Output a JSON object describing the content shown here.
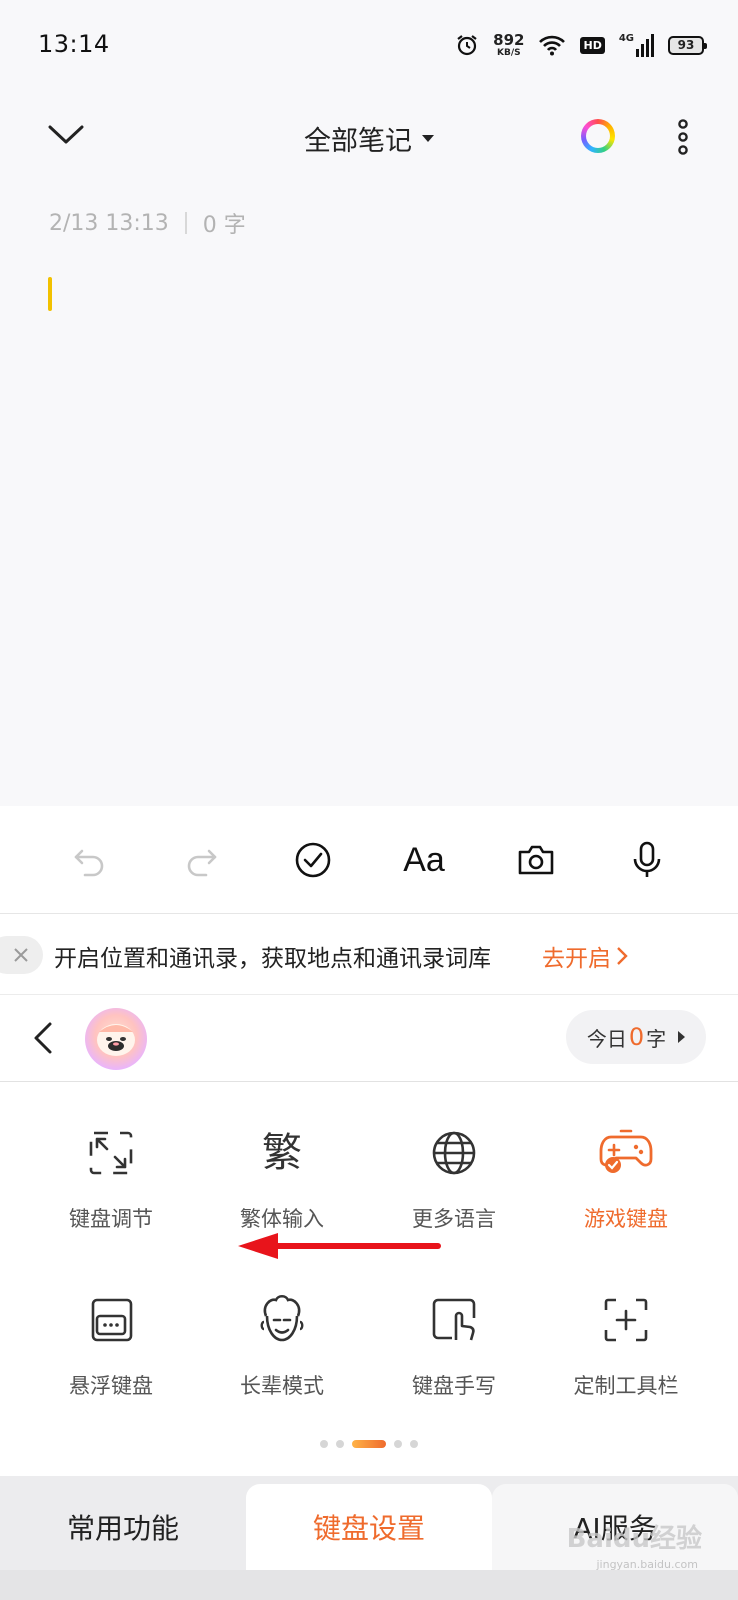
{
  "status_bar": {
    "time": "13:14",
    "net_speed_value": "892",
    "net_speed_unit": "KB/S",
    "hd_label": "HD",
    "network_label": "4G",
    "battery": "93"
  },
  "header": {
    "title": "全部笔记"
  },
  "note": {
    "timestamp": "2/13 13:13",
    "word_count": "0 字",
    "cursor_color": "#f2c100"
  },
  "notice": {
    "message": "开启位置和通讯录，获取地点和通讯录词库",
    "action": "去开启"
  },
  "account": {
    "today_prefix": "今日",
    "today_count": "0",
    "today_suffix": "字"
  },
  "functions": [
    {
      "label": "键盘调节",
      "icon": "resize-icon"
    },
    {
      "label": "繁体输入",
      "icon": "traditional-char-icon",
      "glyph": "繁"
    },
    {
      "label": "更多语言",
      "icon": "globe-icon"
    },
    {
      "label": "游戏键盘",
      "icon": "gamepad-icon",
      "active": true
    },
    {
      "label": "悬浮键盘",
      "icon": "floating-keyboard-icon"
    },
    {
      "label": "长辈模式",
      "icon": "elder-face-icon"
    },
    {
      "label": "键盘手写",
      "icon": "handwriting-icon"
    },
    {
      "label": "定制工具栏",
      "icon": "custom-toolbar-icon"
    }
  ],
  "page_indicator": {
    "total": 5,
    "current": 3
  },
  "tabs": [
    {
      "label": "常用功能"
    },
    {
      "label": "键盘设置",
      "selected": true
    },
    {
      "label": "AI服务"
    }
  ],
  "watermark": {
    "text": "Baidu经验",
    "sub": "jingyan.baidu.com"
  },
  "colors": {
    "accent": "#ef6b2d",
    "annotation_arrow": "#e8141b"
  }
}
